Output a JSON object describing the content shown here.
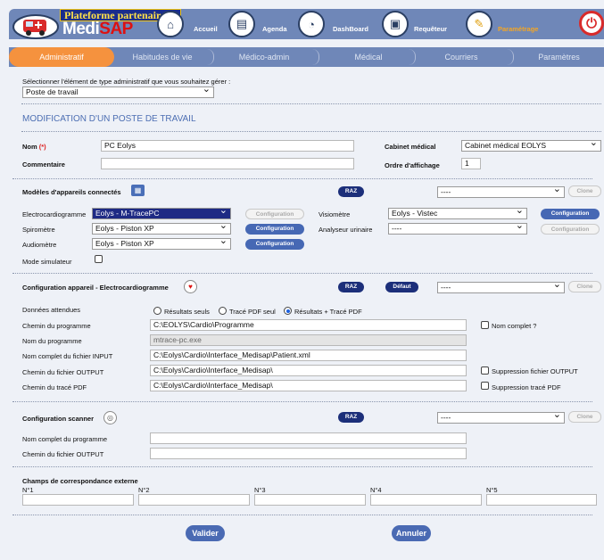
{
  "header": {
    "badge": "Plateforme partenaires",
    "logo_medi": "Medi",
    "logo_sap": "SAP",
    "nav": [
      {
        "label": "Accueil",
        "icon": "home-icon"
      },
      {
        "label": "Agenda",
        "icon": "notebook-icon"
      },
      {
        "label": "DashBoard",
        "icon": "pie-chart-icon"
      },
      {
        "label": "Requêteur",
        "icon": "printer-icon"
      },
      {
        "label": "Paramétrage",
        "icon": "tools-icon"
      }
    ],
    "accent_color": "#f5923e"
  },
  "tabs": [
    "Administratif",
    "Habitudes de vie",
    "Médico-admin",
    "Médical",
    "Courriers",
    "Paramètres"
  ],
  "selector": {
    "label": "Sélectionner l'élément de type administratif que vous souhaitez gérer :",
    "value": "Poste de travail"
  },
  "section_title": "MODIFICATION D'UN POSTE DE TRAVAIL",
  "form": {
    "nom_label": "Nom",
    "required_mark": "(*)",
    "nom_value": "PC Eolys",
    "commentaire_label": "Commentaire",
    "commentaire_value": "",
    "cabinet_label": "Cabinet médical",
    "cabinet_value": "Cabinet médical EOLYS",
    "ordre_label": "Ordre d'affichage",
    "ordre_value": "1"
  },
  "devices": {
    "title": "Modèles d'appareils connectés",
    "raz": "RAZ",
    "preset_value": "----",
    "clone": "Clone",
    "config": "Configuration",
    "ecg_label": "Electrocardiogramme",
    "ecg_value": "Eolys - M-TracePC",
    "spiro_label": "Spiromètre",
    "spiro_value": "Eolys - Piston XP",
    "audio_label": "Audiomètre",
    "audio_value": "Eolys - Piston XP",
    "visio_label": "Visiomètre",
    "visio_value": "Eolys - Vistec",
    "urin_label": "Analyseur urinaire",
    "urin_value": "----",
    "simu_label": "Mode simulateur"
  },
  "config_ecg": {
    "title": "Configuration appareil - Electrocardiogramme",
    "raz": "RAZ",
    "defaut": "Défaut",
    "preset_value": "----",
    "clone": "Clone",
    "donnees_label": "Données attendues",
    "opt1": "Résultats seuls",
    "opt2": "Tracé PDF seul",
    "opt3": "Résultats + Tracé PDF",
    "chemin_prog_label": "Chemin du programme",
    "chemin_prog_value": "C:\\EOLYS\\Cardio\\Programme",
    "nom_complet_cb": "Nom complet ?",
    "nom_prog_label": "Nom du programme",
    "nom_prog_value": "mtrace-pc.exe",
    "input_label": "Nom complet du fichier INPUT",
    "input_value": "C:\\Eolys\\Cardio\\Interface_Medisap\\Patient.xml",
    "output_label": "Chemin du fichier OUTPUT",
    "output_value": "C:\\Eolys\\Cardio\\Interface_Medisap\\",
    "supp_output_cb": "Suppression fichier OUTPUT",
    "pdf_label": "Chemin du tracé PDF",
    "pdf_value": "C:\\Eolys\\Cardio\\Interface_Medisap\\",
    "supp_pdf_cb": "Suppression tracé PDF"
  },
  "scanner": {
    "title": "Configuration scanner",
    "raz": "RAZ",
    "preset_value": "----",
    "clone": "Clone",
    "nom_prog_label": "Nom complet du programme",
    "output_label": "Chemin du fichier OUTPUT"
  },
  "external": {
    "title": "Champs de correspondance externe",
    "fields": [
      "N°1",
      "N°2",
      "N°3",
      "N°4",
      "N°5"
    ]
  },
  "actions": {
    "valider": "Valider",
    "annuler": "Annuler"
  }
}
